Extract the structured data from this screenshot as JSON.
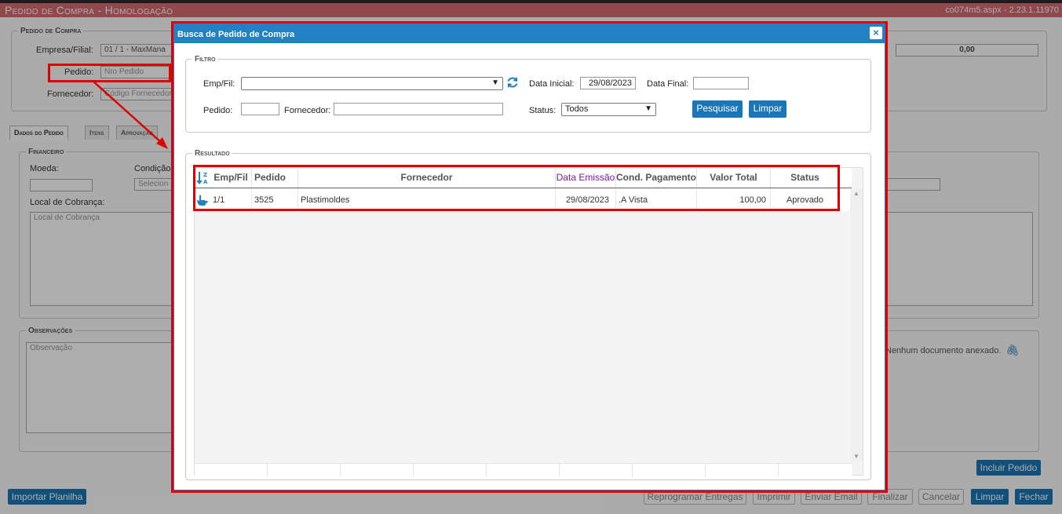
{
  "window": {
    "title": "Pedido de Compra  - Homologação",
    "page_info": "co074m5.aspx - 2.23.1.11970"
  },
  "background": {
    "order_legend": "Pedido de Compra",
    "empresa_label": "Empresa/Filial:",
    "empresa_value": "01 / 1 - MaxMana",
    "pedido_label": "Pedido:",
    "pedido_placeholder": "Nro Pedido",
    "fornecedor_label": "Fornecedor:",
    "fornecedor_placeholder": "Código Fornecedor",
    "total_value": "0,00",
    "tabs": [
      "Dados do Pedido",
      "Itens",
      "Aprovação"
    ],
    "financeiro_legend": "Financeiro",
    "moeda_label": "Moeda:",
    "condicao_label": "Condição",
    "condicao_placeholder": "Selecion",
    "local_label": "Local de Cobrança:",
    "local_placeholder": "Local de Cobrança",
    "observacoes_legend": "Observações",
    "observacao_placeholder": "Observação",
    "anexo_text": "Nenhum documento anexado.",
    "incluir_pedido": "Incluir Pedido",
    "importar_planilha": "Importar Planilha",
    "reprogramar_entregas": "Reprogramar Entregas",
    "imprimir": "Imprimir",
    "enviar_email": "Enviar Email",
    "finalizar": "Finalizar",
    "cancelar": "Cancelar",
    "limpar": "Limpar",
    "fechar": "Fechar"
  },
  "modal": {
    "title": "Busca de Pedido de Compra",
    "close_glyph": "×",
    "filtro_legend": "Filtro",
    "empfil_label": "Emp/Fil:",
    "empfil_value": "",
    "refresh_icon": "refresh-icon",
    "data_inicial_label": "Data Inicial:",
    "data_inicial_value": "29/08/2023",
    "data_final_label": "Data Final:",
    "data_final_value": "",
    "pedido_label": "Pedido:",
    "pedido_value": "",
    "fornecedor_label": "Fornecedor:",
    "fornecedor_value": "",
    "status_label": "Status:",
    "status_value": "Todos",
    "pesquisar": "Pesquisar",
    "limpar": "Limpar",
    "resultado_legend": "Resultado",
    "columns": [
      "Emp/Fil",
      "Pedido",
      "Fornecedor",
      "Data Emissão",
      "Cond. Pagamento",
      "Valor Total",
      "Status"
    ],
    "rows": [
      {
        "emp_fil": "1/1",
        "pedido": "3525",
        "fornecedor": "Plastimoldes",
        "data_emissao": "29/08/2023",
        "cond_pagamento": ".A Vista",
        "valor_total": "100,00",
        "status": "Aprovado"
      }
    ]
  },
  "colors": {
    "title_bar": "#d46b72",
    "modal_header": "#2281c3",
    "button_blue": "#1a76b6",
    "highlight_red": "#e00000",
    "sorted_column": "#7a1a9a"
  }
}
